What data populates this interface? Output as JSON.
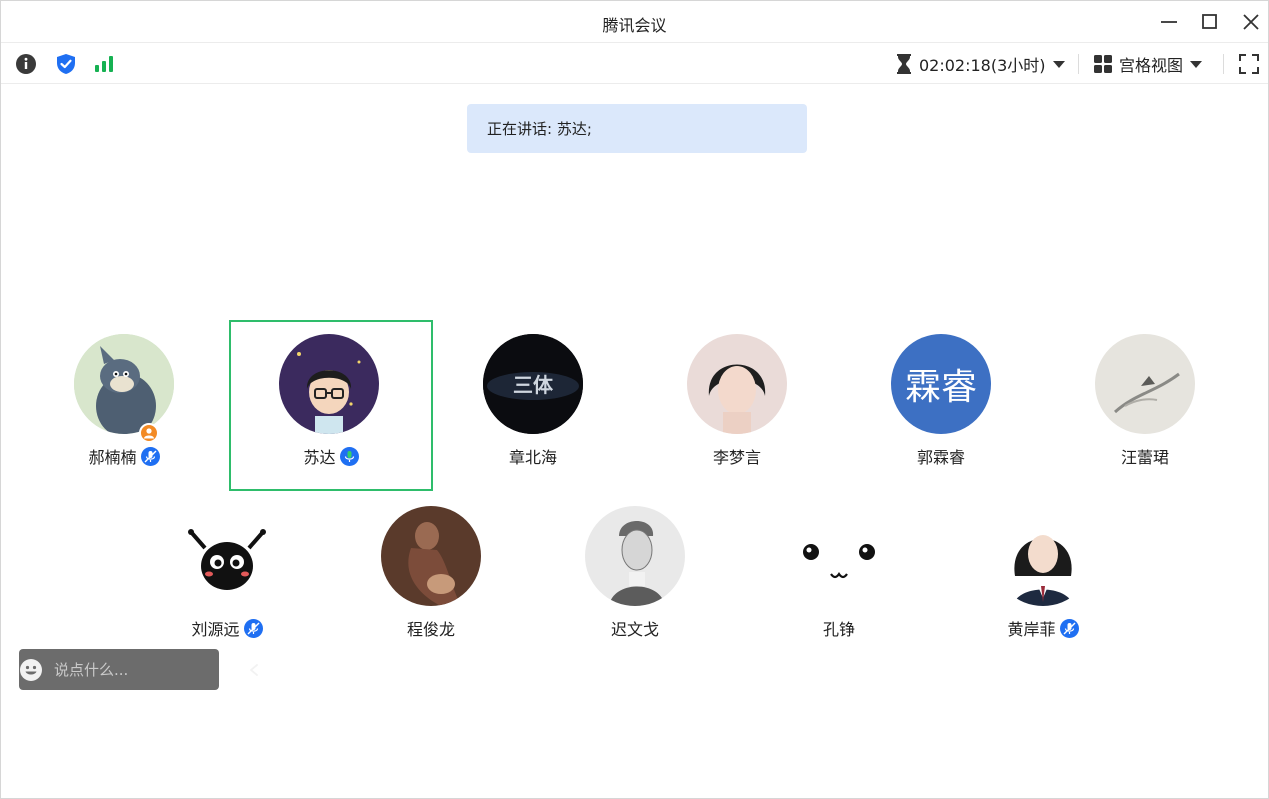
{
  "window": {
    "title": "腾讯会议"
  },
  "toolbar": {
    "timer_text": "02:02:18(3小时)",
    "layout_label": "宫格视图"
  },
  "speaking_banner": "正在讲话: 苏达;",
  "participants": [
    {
      "name": "郝楠楠",
      "muted": true,
      "host": true
    },
    {
      "name": "苏达",
      "speaking": true,
      "muted": false
    },
    {
      "name": "章北海",
      "avatar_text": "三体"
    },
    {
      "name": "李梦言"
    },
    {
      "name": "郭霖睿",
      "avatar_text": "霖睿",
      "avatar_color": "#3d70c3"
    },
    {
      "name": "汪蕾珺"
    },
    {
      "name": "刘源远",
      "muted": true
    },
    {
      "name": "程俊龙"
    },
    {
      "name": "迟文戈"
    },
    {
      "name": "孔铮"
    },
    {
      "name": "黄岸菲",
      "muted": true
    }
  ],
  "chat": {
    "placeholder": "说点什么..."
  },
  "colors": {
    "accent_blue": "#1f6ff2",
    "active_green": "#2ebd6b",
    "banner_bg": "#dbe8fb",
    "signal_green": "#16b152"
  }
}
